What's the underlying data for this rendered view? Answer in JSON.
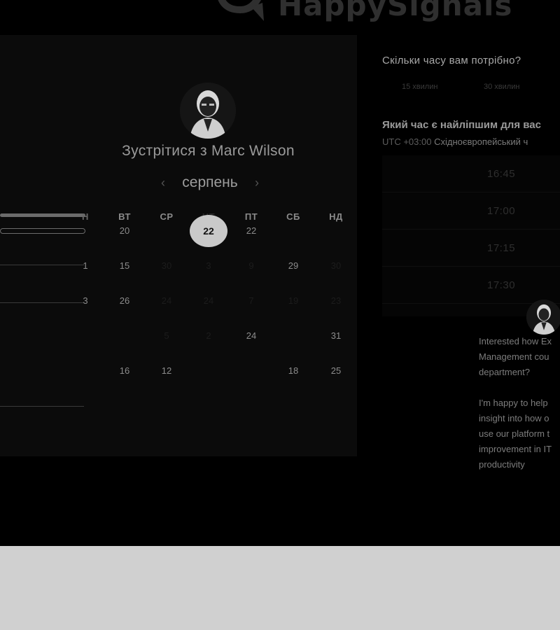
{
  "brand": {
    "name": "HappySignals"
  },
  "calendar": {
    "title": "Зустрітися з Marc Wilson",
    "month": "серпень",
    "prev_icon": "chevron-left-icon",
    "next_icon": "chevron-right-icon",
    "weekdays": [
      "Н",
      "ВТ",
      "СР",
      "ЧТ",
      "ПТ",
      "СБ",
      "НД"
    ],
    "selected_day": "22",
    "weeks": [
      [
        "",
        "20",
        "",
        "22",
        "22",
        "",
        ""
      ],
      [
        "1",
        "15",
        "30",
        "3",
        "9",
        "29",
        "30"
      ],
      [
        "3",
        "26",
        "24",
        "24",
        "7",
        "19",
        "23"
      ],
      [
        "",
        "",
        "5",
        "2",
        "24",
        "",
        "31"
      ],
      [
        "",
        "16",
        "12",
        "",
        "",
        "18",
        "25"
      ],
      [
        "",
        "",
        "",
        "",
        "",
        "",
        ""
      ]
    ]
  },
  "booking": {
    "duration_question": "Скільки часу вам потрібно?",
    "durations": [
      "15 хвилин",
      "30 хвилин"
    ],
    "time_question": "Який час є найліпшим для вас",
    "timezone_offset": "UTC +03:00",
    "timezone_name": "Східноєвропейський ч",
    "time_slots": [
      "16:45",
      "17:00",
      "17:15",
      "17:30"
    ]
  },
  "chat": {
    "message": "Interested how Ex\nManagement cou\ndepartment?\n\nI'm happy to help\ninsight into how o\nuse our platform t\nimprovement in IT\nproductivity"
  }
}
